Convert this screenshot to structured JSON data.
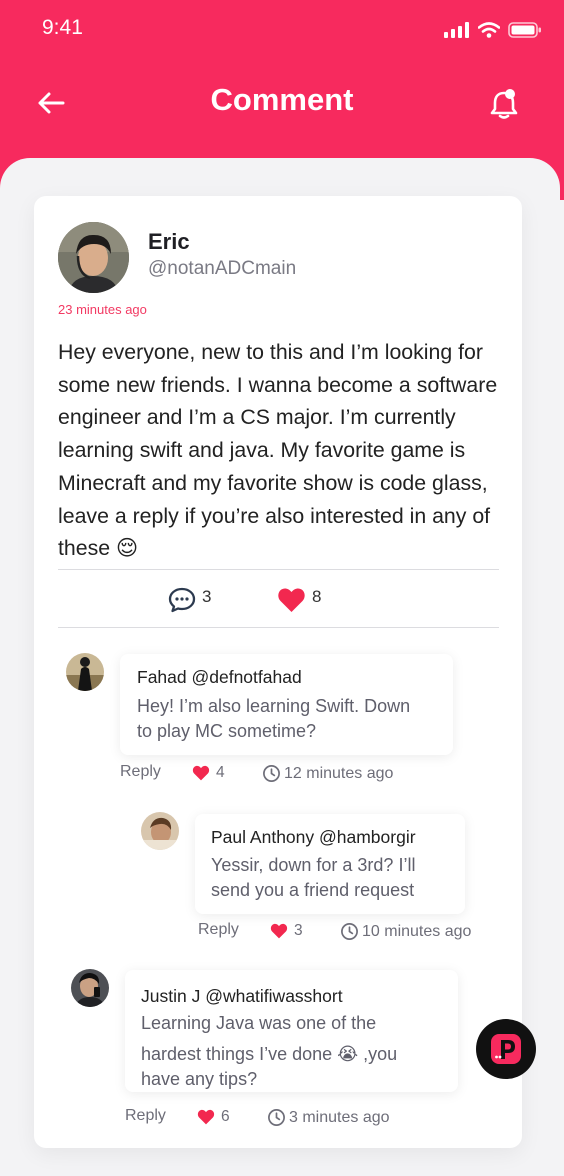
{
  "status_bar": {
    "time": "9:41"
  },
  "nav": {
    "title": "Comment"
  },
  "post": {
    "author": "Eric",
    "handle": "@notanADCmain",
    "time_ago": "23 minutes ago",
    "body": "Hey everyone, new to this and I’m looking for some new friends. I wanna become a software engineer and I’m a CS major. I’m currently learning swift and java. My favorite game is Minecraft and my favorite show is code glass, leave a reply if you’re also interested in any of these 😌",
    "comment_count": "3",
    "like_count": "8"
  },
  "comments": [
    {
      "author": "Fahad @defnotfahad",
      "text": "Hey! I’m also learning Swift. Down to play MC sometime?",
      "reply_label": "Reply",
      "likes": "4",
      "time": "12 minutes ago"
    },
    {
      "author": "Paul Anthony @hamborgir",
      "text": "Yessir, down for a 3rd? I’ll send you a friend request",
      "reply_label": "Reply",
      "likes": "3",
      "time": "10  minutes ago"
    },
    {
      "author": "Justin J @whatifiwasshort",
      "text_line1": "Learning Java was one of the",
      "text_line2": "hardest things I’ve done 😭 ,you have any tips?",
      "reply_label": "Reply",
      "likes": "6",
      "time": "3 minutes ago"
    }
  ],
  "colors": {
    "accent": "#f72a5e",
    "heart": "#f2284f",
    "fab_bg": "#111111"
  },
  "icons": [
    "back-arrow-icon",
    "bell-icon",
    "comment-icon",
    "heart-icon",
    "clock-icon",
    "app-logo-icon",
    "signal-icon",
    "wifi-icon",
    "battery-icon"
  ]
}
